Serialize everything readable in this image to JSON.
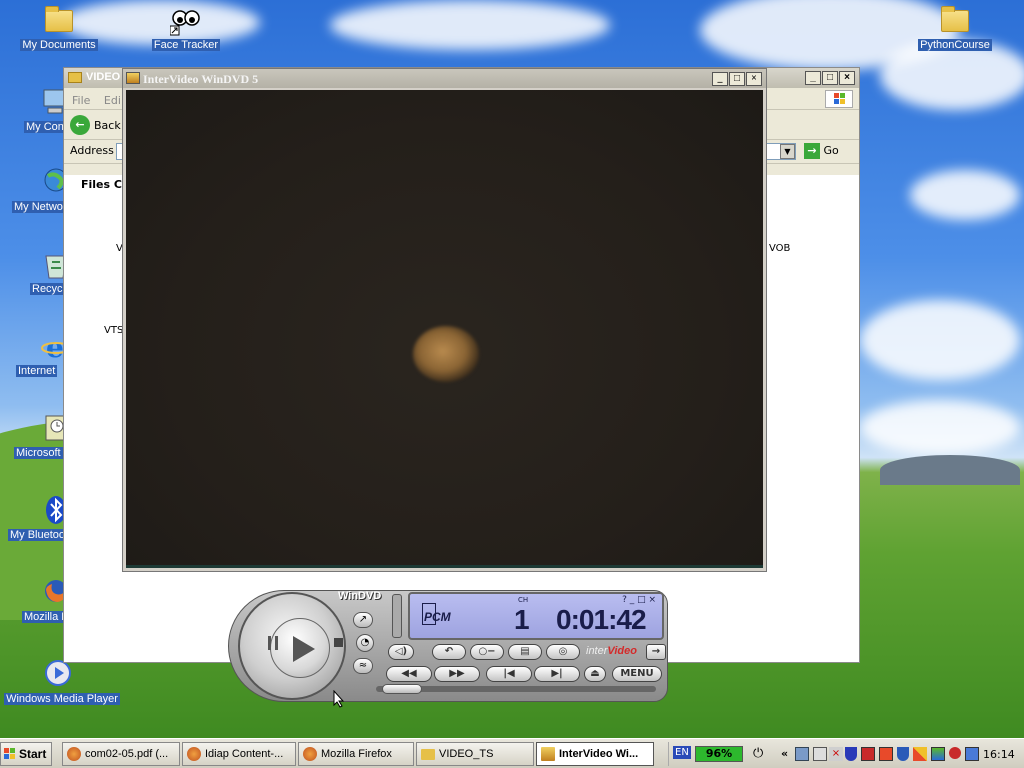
{
  "desktop": {
    "icons": [
      {
        "label": "My Documents"
      },
      {
        "label": "Face Tracker"
      },
      {
        "label": "PythonCourse"
      },
      {
        "label": "My Con"
      },
      {
        "label": "My Netwo"
      },
      {
        "label": "Recyc"
      },
      {
        "label": "Internet"
      },
      {
        "label": "Microsoft"
      },
      {
        "label": "My Bluetoo"
      },
      {
        "label": "Mozilla F"
      },
      {
        "label": "Windows Media Player"
      }
    ]
  },
  "explorer": {
    "title": "VIDEO",
    "menu": [
      "File",
      "Edi"
    ],
    "back_label": "Back",
    "address_label": "Address",
    "go_label": "Go",
    "files_heading": "Files Cu",
    "file_left_1": "V",
    "file_left_2": "VTS",
    "file_right_1": "VOB"
  },
  "windvd": {
    "title": "InterVideo WinDVD 5",
    "controller": {
      "brand": "WinDVD",
      "audio_format": "PCM",
      "ch_label": "CH",
      "chapter": "1",
      "time_h": "0",
      "time_m": "01",
      "time_s": "42",
      "logo_inter": "inter",
      "logo_video": "Video",
      "menu_label": "MENU"
    }
  },
  "taskbar": {
    "start_label": "Start",
    "tasks": [
      {
        "label": "com02-05.pdf (..."
      },
      {
        "label": "Idiap Content-..."
      },
      {
        "label": "Mozilla Firefox"
      },
      {
        "label": "VIDEO_TS"
      },
      {
        "label": "InterVideo Wi..."
      }
    ],
    "language": "EN",
    "battery": "96%",
    "clock": "16:14"
  },
  "colors": {
    "xp_blue": "#2f5fb0",
    "battery_green": "#2db82d",
    "lcd_blue": "#b9bdf0"
  }
}
